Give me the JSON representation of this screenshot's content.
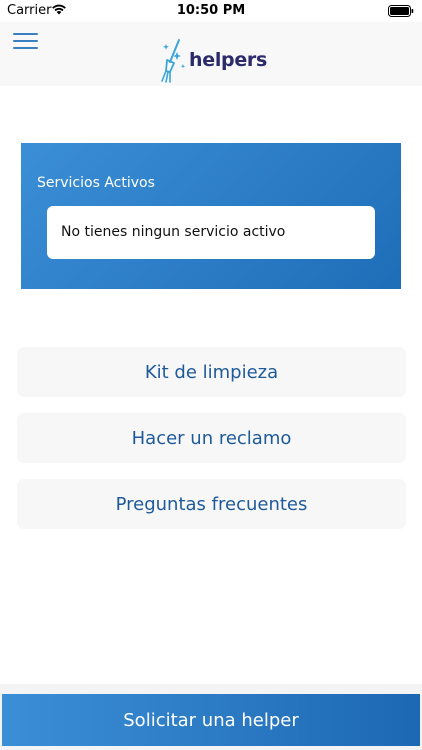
{
  "status_bar": {
    "carrier": "Carrier",
    "time": "10:50 PM",
    "icons": [
      "wifi-icon",
      "battery-icon"
    ]
  },
  "header": {
    "menu_icon": "hamburger-menu-icon",
    "logo_text": "helpers",
    "logo_icon": "broom-sparkle-icon"
  },
  "active_services": {
    "title": "Servicios Activos",
    "empty_message": "No tienes ningun servicio activo"
  },
  "options": [
    {
      "label": "Kit de limpieza"
    },
    {
      "label": "Hacer un reclamo"
    },
    {
      "label": "Preguntas frecuentes"
    }
  ],
  "cta": {
    "label": "Solicitar una helper"
  },
  "colors": {
    "accent": "#2a7dc8",
    "brand_dark": "#2b2a6b",
    "button_text": "#1e5a9a"
  }
}
